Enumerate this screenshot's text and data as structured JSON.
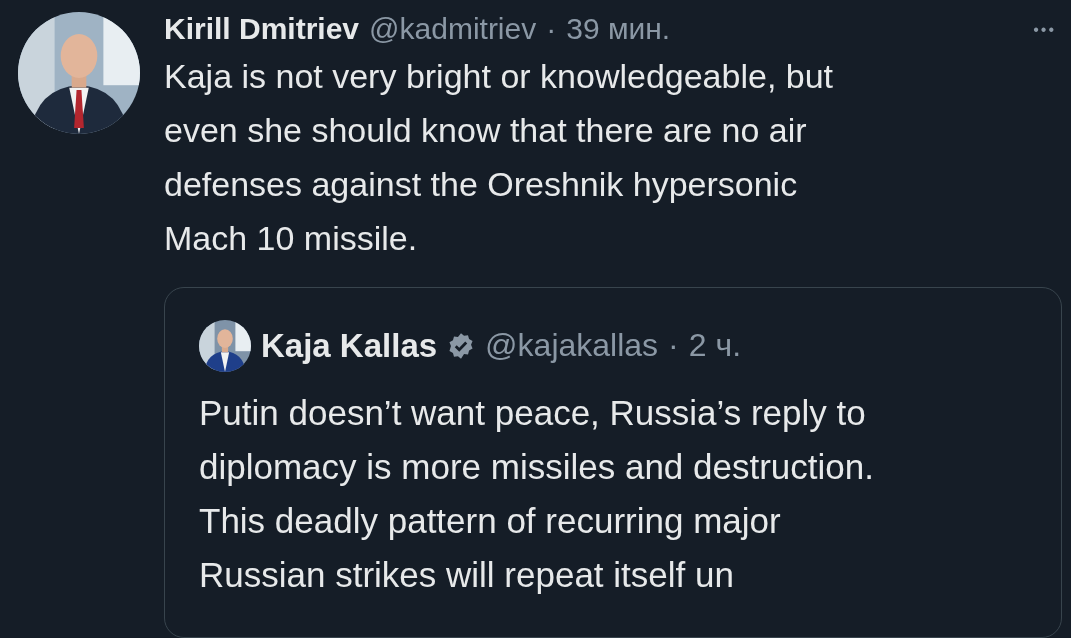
{
  "post": {
    "author": "Kirill Dmitriev",
    "handle": "@kadmitriev",
    "separator": "·",
    "time": "39 мин.",
    "more": "•••",
    "text_lines": [
      "Kaja is not very bright or knowledgeable, but",
      "even she should know that there are no air",
      "defenses against the Oreshnik hypersonic",
      "Mach 10 missile."
    ]
  },
  "quoted_post": {
    "author": "Kaja Kallas",
    "verified": true,
    "handle": "@kajakallas",
    "separator": "·",
    "time": "2 ч.",
    "text_lines": [
      "Putin doesn’t want peace, Russia’s reply to",
      "diplomacy is more missiles and destruction.",
      "This deadly pattern of recurring major",
      "Russian strikes will repeat itself un"
    ]
  }
}
